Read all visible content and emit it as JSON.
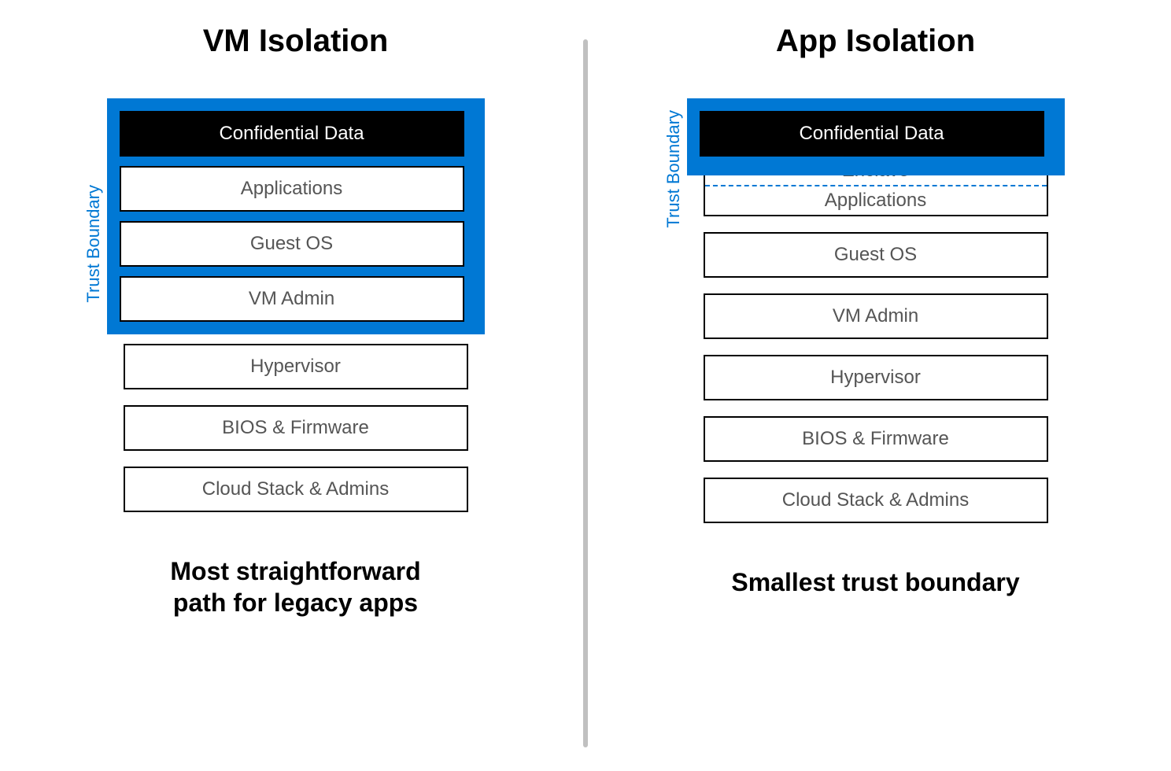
{
  "left": {
    "title": "VM Isolation",
    "trust_label": "Trust Boundary",
    "trusted_layers": [
      "Confidential Data",
      "Applications",
      "Guest OS",
      "VM Admin"
    ],
    "untrusted_layers": [
      "Hypervisor",
      "BIOS & Firmware",
      "Cloud Stack & Admins"
    ],
    "caption_line1": "Most straightforward",
    "caption_line2": "path for legacy apps"
  },
  "right": {
    "title": "App Isolation",
    "trust_label": "Trust Boundary",
    "confidential": "Confidential Data",
    "enclave_label": "Enclave",
    "applications_label": "Applications",
    "untrusted_layers": [
      "Guest OS",
      "VM Admin",
      "Hypervisor",
      "BIOS & Firmware",
      "Cloud Stack & Admins"
    ],
    "caption": "Smallest trust boundary"
  },
  "colors": {
    "accent": "#0078d4",
    "black": "#000000",
    "text_muted": "#555555",
    "divider": "#c0c0c0"
  }
}
